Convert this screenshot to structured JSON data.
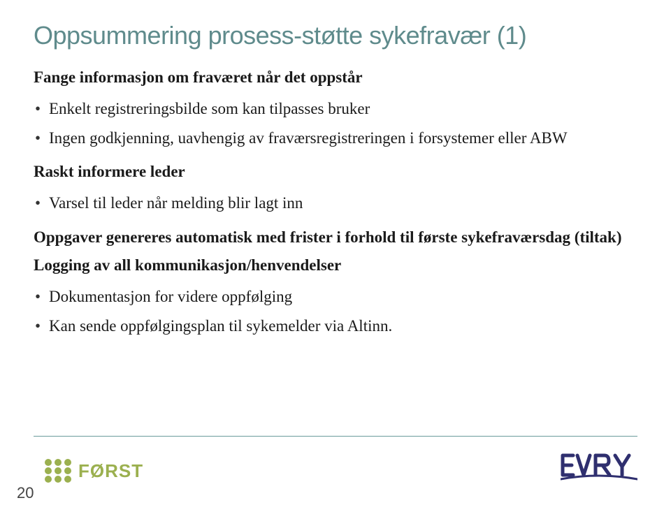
{
  "title": "Oppsummering prosess-støtte sykefravær (1)",
  "sections": [
    {
      "heading": "Fange informasjon om fraværet når det oppstår",
      "bullets": [
        "Enkelt registreringsbilde som kan tilpasses bruker",
        "Ingen godkjenning, uavhengig av fraværsregistreringen i forsystemer eller ABW"
      ]
    },
    {
      "heading": "Raskt informere leder",
      "bullets": [
        "Varsel til leder når melding blir lagt inn"
      ]
    },
    {
      "heading": "Oppgaver genereres automatisk med frister i forhold til første sykefraværsdag (tiltak)",
      "bullets": []
    },
    {
      "heading": "Logging av all kommunikasjon/henvendelser",
      "bullets": [
        "Dokumentasjon for videre oppfølging",
        "Kan sende oppfølgingsplan til sykemelder via Altinn."
      ]
    }
  ],
  "footer": {
    "page": "20",
    "logo_left": "FØRST",
    "logo_right": "EVRY"
  },
  "colors": {
    "title": "#5f8b8c",
    "forst": "#9bb04f",
    "evry": "#3a3a7a"
  }
}
